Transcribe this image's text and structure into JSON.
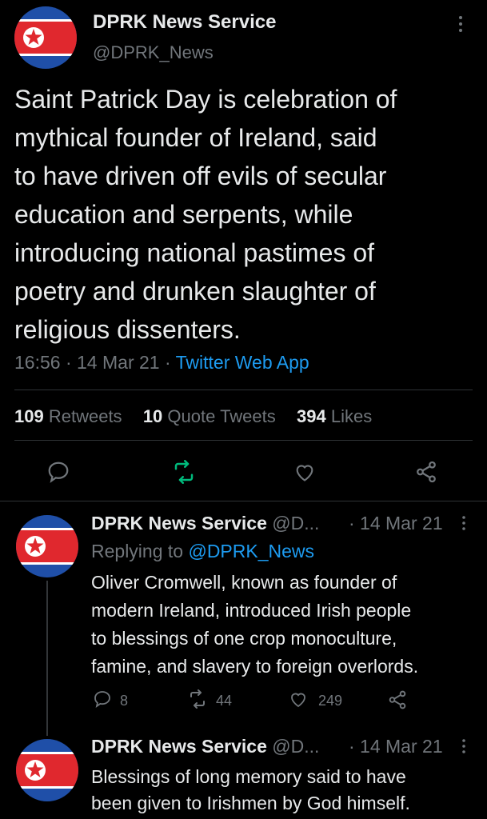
{
  "main_tweet": {
    "author_name": "DPRK News Service",
    "handle": "@DPRK_News",
    "text_lines": [
      "Saint Patrick Day is celebration of",
      "mythical founder of Ireland, said",
      "to have driven off evils of secular",
      "education and serpents, while",
      "introducing national pastimes of",
      "poetry and drunken slaughter of",
      "religious dissenters."
    ],
    "time": "16:56",
    "separator": "·",
    "date": "14 Mar 21",
    "source": "Twitter Web App",
    "stats": {
      "retweets_count": "109",
      "retweets_label": "Retweets",
      "quotes_count": "10",
      "quotes_label": "Quote Tweets",
      "likes_count": "394",
      "likes_label": "Likes"
    }
  },
  "replies": [
    {
      "author_name": "DPRK News Service",
      "handle_truncated": "@D...",
      "date": "· 14 Mar 21",
      "replying_prefix": "Replying to",
      "replying_handle": "@DPRK_News",
      "text_lines": [
        "Oliver Cromwell, known as founder of",
        "modern Ireland, introduced Irish people",
        "to blessings of one crop monoculture,",
        "famine, and slavery to foreign overlords."
      ],
      "reply_count": "8",
      "retweet_count": "44",
      "like_count": "249"
    },
    {
      "author_name": "DPRK News Service",
      "handle_truncated": "@D...",
      "date": "· 14 Mar 21",
      "text_lines": [
        "Blessings of long memory said to have",
        "been given to Irishmen by God himself."
      ]
    }
  ],
  "colors": {
    "background": "#000000",
    "text": "#e7e9ea",
    "muted": "#71767b",
    "link": "#1d9bf0",
    "retweet_active": "#00ba7c",
    "flag_blue": "#1f4fa8",
    "flag_red": "#e0282e"
  },
  "icons": [
    "kebab-icon",
    "reply-icon",
    "retweet-icon",
    "like-icon",
    "share-icon"
  ]
}
